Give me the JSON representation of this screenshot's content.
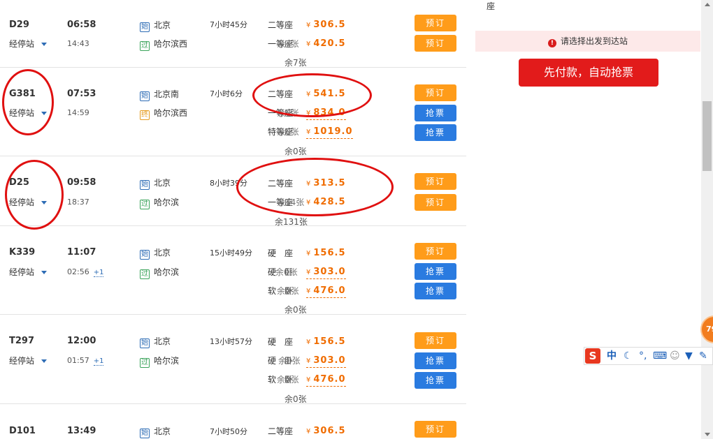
{
  "trains": [
    {
      "number": "D29",
      "stops_label": "经停站",
      "depart_time": "06:58",
      "arrive_time": "14:43",
      "day_plus": "",
      "from_tag": "始",
      "from_station": "北京",
      "to_tag": "过",
      "to_station": "哈尔滨西",
      "duration": "7小时45分",
      "seats": [
        {
          "class": "二等座",
          "price": "306.5",
          "button": "预订",
          "button_color": "orange"
        },
        {
          "class": "一等座",
          "price": "420.5",
          "overlap_text": "余7张",
          "button": "预订",
          "button_color": "orange"
        }
      ],
      "remaining": "余7张"
    },
    {
      "number": "G381",
      "stops_label": "经停站",
      "depart_time": "07:53",
      "arrive_time": "14:59",
      "day_plus": "",
      "from_tag": "始",
      "from_station": "北京南",
      "to_tag": "终",
      "to_station": "哈尔滨西",
      "duration": "7小时6分",
      "seats": [
        {
          "class": "二等座",
          "price": "541.5",
          "button": "预订",
          "button_color": "orange"
        },
        {
          "class": "一等座",
          "price": "834.0",
          "overlap_text": "余0张",
          "button": "抢票",
          "button_color": "blue"
        },
        {
          "class": "特等座",
          "price": "1019.0",
          "overlap_text": "余0张",
          "button": "抢票",
          "button_color": "blue"
        }
      ],
      "remaining": "余0张"
    },
    {
      "number": "D25",
      "stops_label": "经停站",
      "depart_time": "09:58",
      "arrive_time": "18:37",
      "day_plus": "",
      "from_tag": "始",
      "from_station": "北京",
      "to_tag": "过",
      "to_station": "哈尔滨",
      "duration": "8小时39分",
      "seats": [
        {
          "class": "二等座",
          "price": "313.5",
          "button": "预订",
          "button_color": "orange"
        },
        {
          "class": "一等座",
          "price": "428.5",
          "overlap_text": "余14张",
          "button": "预订",
          "button_color": "orange"
        }
      ],
      "remaining": "余131张"
    },
    {
      "number": "K339",
      "stops_label": "经停站",
      "depart_time": "11:07",
      "arrive_time": "02:56",
      "day_plus": "+1",
      "from_tag": "始",
      "from_station": "北京",
      "to_tag": "过",
      "to_station": "哈尔滨",
      "duration": "15小时49分",
      "seats": [
        {
          "class": "硬　座",
          "price": "156.5",
          "button": "预订",
          "button_color": "orange"
        },
        {
          "class": "硬　卧",
          "price": "303.0",
          "overlap_text": "余0张",
          "button": "抢票",
          "button_color": "blue"
        },
        {
          "class": "软　卧",
          "price": "476.0",
          "overlap_text": "余0张",
          "button": "抢票",
          "button_color": "blue"
        }
      ],
      "remaining": "余0张"
    },
    {
      "number": "T297",
      "stops_label": "经停站",
      "depart_time": "12:00",
      "arrive_time": "01:57",
      "day_plus": "+1",
      "from_tag": "始",
      "from_station": "北京",
      "to_tag": "过",
      "to_station": "哈尔滨",
      "duration": "13小时57分",
      "seats": [
        {
          "class": "硬　座",
          "price": "156.5",
          "button": "预订",
          "button_color": "orange"
        },
        {
          "class": "硬　卧",
          "price": "303.0",
          "overlap_text": "余0张",
          "button": "抢票",
          "button_color": "blue"
        },
        {
          "class": "软　卧",
          "price": "476.0",
          "overlap_text": "余0张",
          "button": "抢票",
          "button_color": "blue"
        }
      ],
      "remaining": "余0张"
    },
    {
      "number": "D101",
      "stops_label": "",
      "depart_time": "13:49",
      "arrive_time": "",
      "day_plus": "",
      "from_tag": "始",
      "from_station": "北京",
      "to_tag": "",
      "to_station": "",
      "duration": "7小时50分",
      "seats": [
        {
          "class": "二等座",
          "price": "306.5",
          "button": "预订",
          "button_color": "orange"
        }
      ],
      "remaining": ""
    }
  ],
  "currency_symbol": "¥",
  "right_panel": {
    "top_cut_text": "座",
    "warning_text": "请选择出发到达站",
    "pay_button": "先付款，自动抢票"
  },
  "badge_text": "79",
  "ime": {
    "logo": "S",
    "mode": "中",
    "icons": [
      "moon-icon",
      "punctuation-icon",
      "keyboard-icon",
      "user-icon",
      "skin-icon",
      "wrench-icon"
    ]
  },
  "colors": {
    "book_button": "#ff9c1a",
    "grab_button": "#2a7be0",
    "price": "#f06c00",
    "pay_button": "#e21b1b",
    "annotation_circle": "#e01010"
  }
}
